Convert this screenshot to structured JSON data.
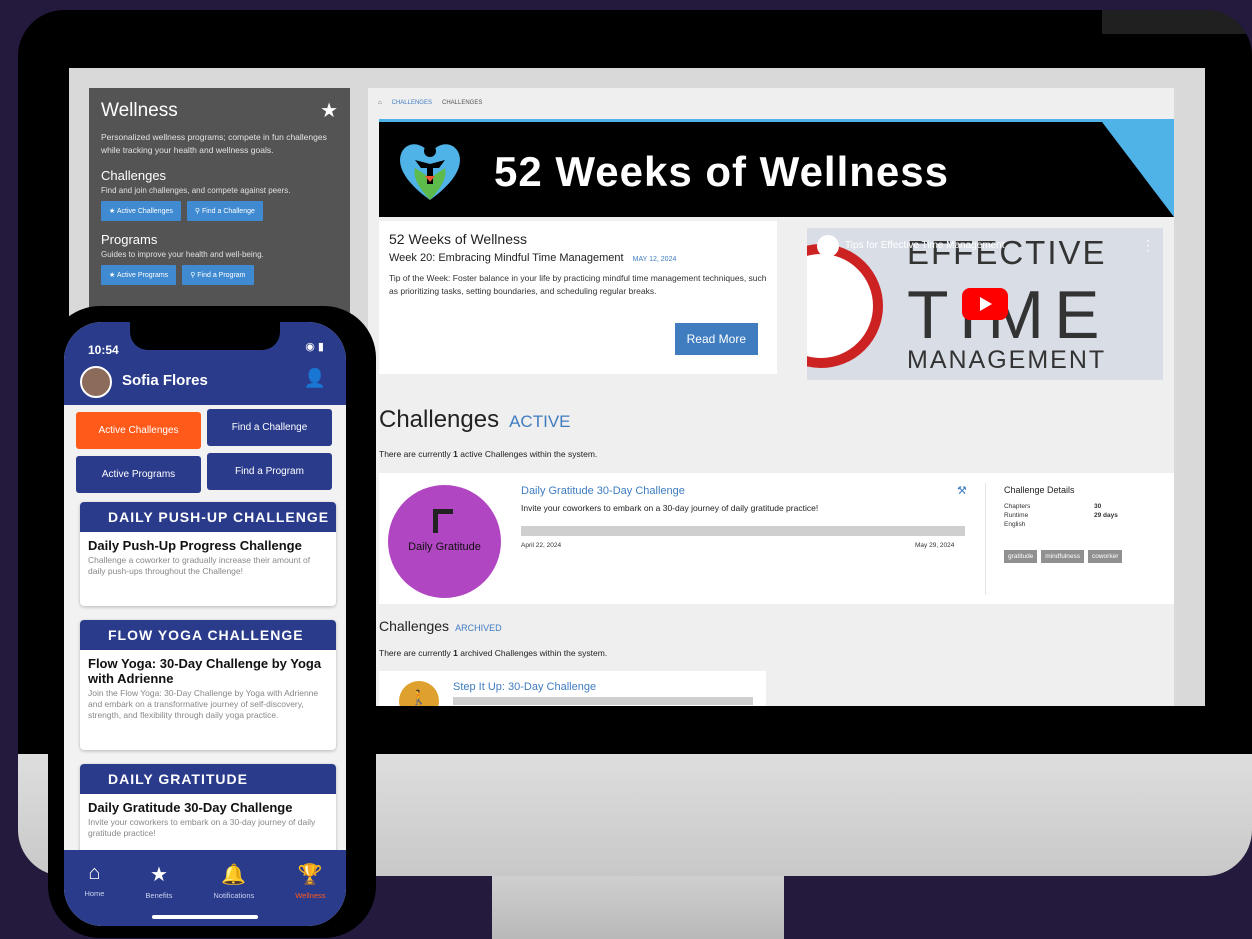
{
  "sidebar": {
    "title": "Wellness",
    "intro": "Personalized wellness programs; compete in fun challenges while tracking your health and wellness goals.",
    "challenges_heading": "Challenges",
    "challenges_sub": "Find and join challenges, and compete against peers.",
    "active_challenges_btn": "★ Active Challenges",
    "find_challenge_btn": "⚲ Find a Challenge",
    "programs_heading": "Programs",
    "programs_sub": "Guides to improve your health and well-being.",
    "active_programs_btn": "★ Active Programs",
    "find_program_btn": "⚲ Find a Program"
  },
  "breadcrumb": {
    "home_icon": "home-icon",
    "link": "CHALLENGES",
    "current": "CHALLENGES"
  },
  "banner": {
    "title": "52 Weeks of Wellness"
  },
  "week": {
    "title": "52 Weeks of Wellness",
    "subtitle": "Week 20: Embracing Mindful Time Management",
    "date": "MAY 12, 2024",
    "body": "Tip of the Week: Foster balance in your life by practicing mindful time management techniques, such as prioritizing tasks, setting boundaries, and scheduling regular breaks.",
    "read_more": "Read More"
  },
  "video": {
    "title": "Tips for Effective Time Management",
    "line1": "EFFECTIVE",
    "line2": "TIME",
    "line3": "MANAGEMENT"
  },
  "active": {
    "heading": "Challenges",
    "tag": "ACTIVE",
    "count_pre": "There are currently ",
    "count": "1",
    "count_post": " active Challenges within the system.",
    "challenge": {
      "badge_text": "Daily Gratitude",
      "name": "Daily Gratitude 30-Day Challenge",
      "description": "Invite your coworkers to embark on a 30-day journey of daily gratitude practice!",
      "start": "April 22, 2024",
      "end": "May 29, 2024",
      "details_heading": "Challenge Details",
      "chapters_label": "Chapters",
      "chapters": "30",
      "runtime_label": "Runtime",
      "runtime": "29 days",
      "language": "English",
      "tags": [
        "gratitude",
        "mindfulness",
        "coworker"
      ]
    }
  },
  "archived": {
    "heading": "Challenges",
    "tag": "ARCHIVED",
    "count_pre": "There are currently ",
    "count": "1",
    "count_post": " archived Challenges within the system.",
    "challenge_name": "Step It Up: 30-Day Challenge"
  },
  "phone": {
    "time": "10:54",
    "user": "Sofia Flores",
    "buttons": {
      "active_challenges": "Active Challenges",
      "find_challenge": "Find a Challenge",
      "active_programs": "Active Programs",
      "find_program": "Find a Program"
    },
    "cards": [
      {
        "banner": "DAILY PUSH-UP CHALLENGE",
        "title": "Daily Push-Up Progress Challenge",
        "text": "Challenge a coworker to gradually increase their amount of daily push-ups throughout the Challenge!"
      },
      {
        "banner": "FLOW YOGA CHALLENGE",
        "title": "Flow Yoga: 30-Day Challenge by Yoga with Adrienne",
        "text": "Join the Flow Yoga: 30-Day Challenge by Yoga with Adrienne and embark on a transformative journey of self-discovery, strength, and flexibility through daily yoga practice."
      },
      {
        "banner": "DAILY GRATITUDE",
        "title": "Daily Gratitude 30-Day Challenge",
        "text": "Invite your coworkers to embark on a 30-day journey of daily gratitude practice!"
      }
    ],
    "nav": {
      "home": "Home",
      "benefits": "Benefits",
      "notifications": "Notifications",
      "wellness": "Wellness"
    }
  },
  "colors": {
    "brand_blue": "#2a3b8c",
    "accent_orange": "#ff5a1a",
    "link_blue": "#3f7cc0",
    "badge_purple": "#b146c2"
  }
}
